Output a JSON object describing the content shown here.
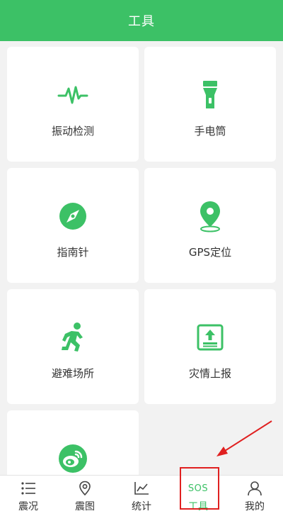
{
  "header": {
    "title": "工具"
  },
  "tools": [
    {
      "label": "振动检测",
      "icon": "waveform-icon"
    },
    {
      "label": "手电筒",
      "icon": "flashlight-icon"
    },
    {
      "label": "指南针",
      "icon": "compass-icon"
    },
    {
      "label": "GPS定位",
      "icon": "location-pin-icon"
    },
    {
      "label": "避难场所",
      "icon": "running-person-icon"
    },
    {
      "label": "灾情上报",
      "icon": "upload-report-icon"
    },
    {
      "label": "",
      "icon": "weibo-icon"
    }
  ],
  "tabbar": {
    "items": [
      {
        "label": "震况",
        "icon": "list-icon"
      },
      {
        "label": "震图",
        "icon": "map-pin-icon"
      },
      {
        "label": "统计",
        "icon": "chart-icon"
      },
      {
        "label": "工具",
        "icon": "sos-icon",
        "icon_text": "SOS",
        "active": true
      },
      {
        "label": "我的",
        "icon": "user-icon"
      }
    ]
  },
  "colors": {
    "brand": "#3cc166",
    "annotation": "#e02020"
  }
}
